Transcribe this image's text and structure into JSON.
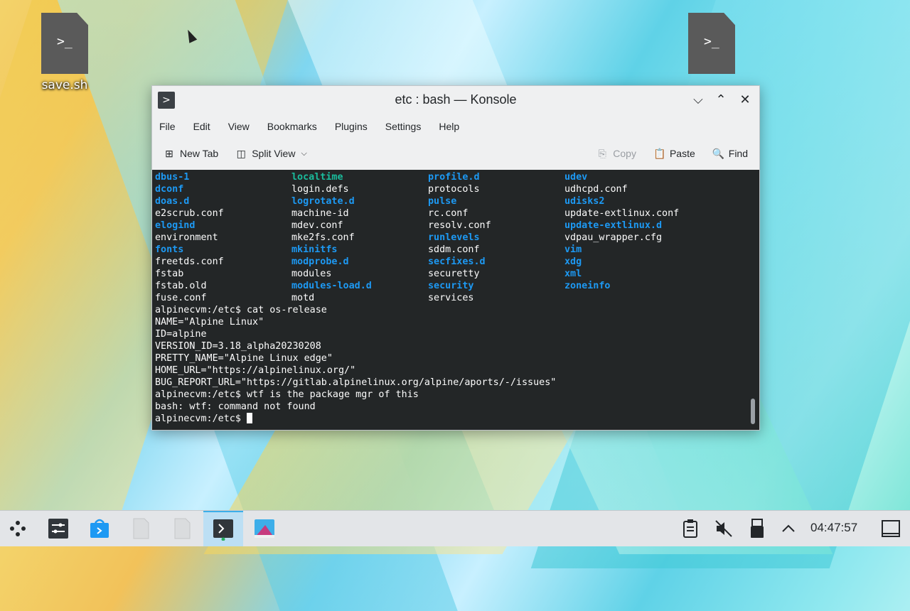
{
  "desktop": {
    "icons": [
      {
        "label": "save.sh",
        "glyph": ">_"
      },
      {
        "label": "",
        "glyph": ">_"
      }
    ]
  },
  "window": {
    "title": "etc : bash — Konsole",
    "app_icon": ">",
    "controls": {
      "minimize": "⌵",
      "maximize": "⌃",
      "close": "✕"
    }
  },
  "menu": [
    "File",
    "Edit",
    "View",
    "Bookmarks",
    "Plugins",
    "Settings",
    "Help"
  ],
  "toolbar": {
    "new_tab": "New Tab",
    "split_view": "Split View",
    "copy": "Copy",
    "paste": "Paste",
    "find": "Find"
  },
  "terminal": {
    "listing": [
      [
        {
          "t": "dbus-1",
          "k": "dir"
        },
        {
          "t": "localtime",
          "k": "lnk"
        },
        {
          "t": "profile.d",
          "k": "dir"
        },
        {
          "t": "udev",
          "k": "dir"
        }
      ],
      [
        {
          "t": "dconf",
          "k": "dir"
        },
        {
          "t": "login.defs",
          "k": "file"
        },
        {
          "t": "protocols",
          "k": "file"
        },
        {
          "t": "udhcpd.conf",
          "k": "file"
        }
      ],
      [
        {
          "t": "doas.d",
          "k": "dir"
        },
        {
          "t": "logrotate.d",
          "k": "dir"
        },
        {
          "t": "pulse",
          "k": "dir"
        },
        {
          "t": "udisks2",
          "k": "dir"
        }
      ],
      [
        {
          "t": "e2scrub.conf",
          "k": "file"
        },
        {
          "t": "machine-id",
          "k": "file"
        },
        {
          "t": "rc.conf",
          "k": "file"
        },
        {
          "t": "update-extlinux.conf",
          "k": "file"
        }
      ],
      [
        {
          "t": "elogind",
          "k": "dir"
        },
        {
          "t": "mdev.conf",
          "k": "file"
        },
        {
          "t": "resolv.conf",
          "k": "file"
        },
        {
          "t": "update-extlinux.d",
          "k": "dir"
        }
      ],
      [
        {
          "t": "environment",
          "k": "file"
        },
        {
          "t": "mke2fs.conf",
          "k": "file"
        },
        {
          "t": "runlevels",
          "k": "dir"
        },
        {
          "t": "vdpau_wrapper.cfg",
          "k": "file"
        }
      ],
      [
        {
          "t": "fonts",
          "k": "dir"
        },
        {
          "t": "mkinitfs",
          "k": "dir"
        },
        {
          "t": "sddm.conf",
          "k": "file"
        },
        {
          "t": "vim",
          "k": "dir"
        }
      ],
      [
        {
          "t": "freetds.conf",
          "k": "file"
        },
        {
          "t": "modprobe.d",
          "k": "dir"
        },
        {
          "t": "secfixes.d",
          "k": "dir"
        },
        {
          "t": "xdg",
          "k": "dir"
        }
      ],
      [
        {
          "t": "fstab",
          "k": "file"
        },
        {
          "t": "modules",
          "k": "file"
        },
        {
          "t": "securetty",
          "k": "file"
        },
        {
          "t": "xml",
          "k": "dir"
        }
      ],
      [
        {
          "t": "fstab.old",
          "k": "file"
        },
        {
          "t": "modules-load.d",
          "k": "dir"
        },
        {
          "t": "security",
          "k": "dir"
        },
        {
          "t": "zoneinfo",
          "k": "dir"
        }
      ],
      [
        {
          "t": "fuse.conf",
          "k": "file"
        },
        {
          "t": "motd",
          "k": "file"
        },
        {
          "t": "services",
          "k": "file"
        },
        {
          "t": "",
          "k": "file"
        }
      ]
    ],
    "lines": [
      "alpinecvm:/etc$ cat os-release",
      "NAME=\"Alpine Linux\"",
      "ID=alpine",
      "VERSION_ID=3.18_alpha20230208",
      "PRETTY_NAME=\"Alpine Linux edge\"",
      "HOME_URL=\"https://alpinelinux.org/\"",
      "BUG_REPORT_URL=\"https://gitlab.alpinelinux.org/alpine/aports/-/issues\"",
      "alpinecvm:/etc$ wtf is the package mgr of this",
      "bash: wtf: command not found"
    ],
    "prompt": "alpinecvm:/etc$ "
  },
  "taskbar": {
    "clock": "04:47:57",
    "icons": [
      "app-launcher-icon",
      "system-settings-icon",
      "discover-store-icon",
      "file-icon",
      "file-icon",
      "konsole-icon",
      "image-viewer-icon"
    ],
    "tray": [
      "clipboard-icon",
      "volume-muted-icon",
      "usb-device-icon",
      "expand-tray-icon"
    ]
  }
}
